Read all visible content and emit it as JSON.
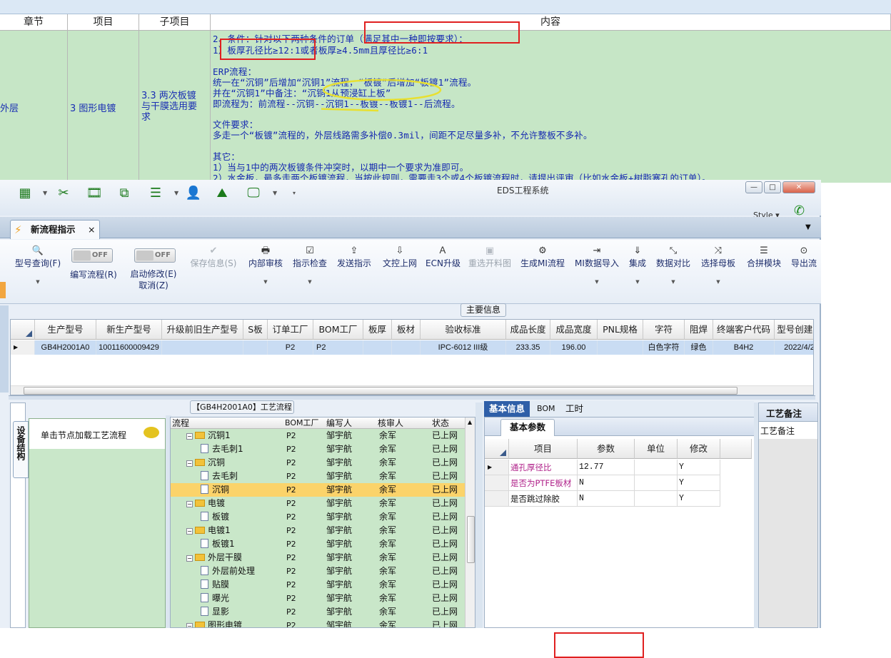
{
  "doc": {
    "headers": [
      "章节",
      "项目",
      "子项目",
      "内容"
    ],
    "row": {
      "chapter": "外层",
      "item": "3 图形电镀",
      "subitem": [
        "3.3 两次板镀",
        "与干膜选用要",
        "求"
      ],
      "content_lines": [
        "2、条件：针对以下两种条件的订单（满足其中一种即按要求）：",
        "1）板厚孔径比≥12:1或者板厚≥4.5mm且厚径比≥6:1",
        "",
        "ERP流程：",
        "统一在“沉铜”后增加“沉铜1”流程，“板镀”后增加“板镀1”流程。",
        "并在“沉铜1”中备注：“沉铜1从预浸缸上板”",
        "即流程为：前流程--沉铜--沉铜1--板镀--板镀1--后流程。",
        "",
        "文件要求：",
        "多走一个“板镀”流程的，外层线路需多补偿0.3mil，间距不足尽量多补，不允许整板不多补。",
        "",
        "其它：",
        "1）当与1中的两次板镀条件冲突时，以期中一个要求为准即可。",
        "2）水金板，最多走两个板镀流程，当按此规则，需要走3个或4个板镀流程时，请提出评审（比如水金板+树脂塞孔的订单）。"
      ]
    }
  },
  "app": {
    "title": "EDS工程系统",
    "style_label": "Style",
    "window_buttons": [
      "—",
      "□",
      "✕"
    ],
    "tab_label": "新流程指示",
    "tab_close": "×",
    "toolbar_icons": [
      "grid-icon",
      "scissors-icon",
      "film-icon",
      "copy-icon",
      "list-icon",
      "user-icon",
      "area-chart-icon",
      "monitor-icon"
    ],
    "ribbon": [
      {
        "icon": "🔍",
        "label": "型号查询(F)",
        "caret": true,
        "disabled": false
      },
      {
        "toggle": "OFF",
        "label": "编写流程(R)"
      },
      {
        "toggle": "OFF",
        "label": "启动修改(E)",
        "label2": "取消(Z)"
      },
      {
        "icon": "✔",
        "label": "保存信息(S)",
        "disabled": true
      },
      {
        "icon": "🖶",
        "label": "内部审核",
        "caret": true
      },
      {
        "icon": "☑",
        "label": "指示检查",
        "caret": true
      },
      {
        "icon": "⇪",
        "label": "发送指示"
      },
      {
        "icon": "⇩",
        "label": "文控上网"
      },
      {
        "icon": "⚑",
        "label": "ECN升级"
      },
      {
        "icon": "▣",
        "label": "重选开料图",
        "disabled": true
      },
      {
        "icon": "⚙",
        "label": "生成MI流程"
      },
      {
        "icon": "⇥",
        "label": "MI数据导入",
        "caret": true
      },
      {
        "icon": "⇓",
        "label": "集成",
        "caret": true
      },
      {
        "icon": "⤡",
        "label": "数据对比",
        "caret": true
      },
      {
        "icon": "⤨",
        "label": "选择母板",
        "caret": true
      },
      {
        "icon": "☰",
        "label": "合拼模块"
      },
      {
        "icon": "⊙",
        "label": "导出流"
      }
    ],
    "main_info": {
      "caption": "主要信息",
      "columns": [
        "生产型号",
        "新生产型号",
        "升级前旧生产型号",
        "S板",
        "订单工厂",
        "BOM工厂",
        "板厚",
        "板材",
        "验收标准",
        "成品长度",
        "成品宽度",
        "PNL规格",
        "字符",
        "阻焊",
        "终端客户代码",
        "型号创建时"
      ],
      "row": [
        "GB4H2001A0",
        "10011600009429",
        "",
        "",
        "P2",
        "P2",
        "",
        "",
        "IPC-6012 III级",
        "233.35",
        "196.00",
        "",
        "白色字符",
        "绿色",
        "B4H2",
        "2022/4/2"
      ]
    },
    "left_panel": {
      "side_tab": "设备结构",
      "hint": "单击节点加载工艺流程"
    },
    "process": {
      "title": "【GB4H2001A0】工艺流程",
      "columns": [
        "流程",
        "BOM工厂",
        "编写人",
        "核审人",
        "状态"
      ],
      "rows": [
        {
          "level": 0,
          "type": "folder",
          "name": "沉铜1",
          "bom": "P2",
          "author": "邹宇航",
          "reviewer": "余军",
          "status": "已上网"
        },
        {
          "level": 1,
          "type": "doc",
          "name": "去毛刺1",
          "bom": "P2",
          "author": "邹宇航",
          "reviewer": "余军",
          "status": "已上网"
        },
        {
          "level": 0,
          "type": "folder",
          "name": "沉铜",
          "bom": "P2",
          "author": "邹宇航",
          "reviewer": "余军",
          "status": "已上网"
        },
        {
          "level": 1,
          "type": "doc",
          "name": "去毛刺",
          "bom": "P2",
          "author": "邹宇航",
          "reviewer": "余军",
          "status": "已上网"
        },
        {
          "level": 1,
          "type": "doc",
          "name": "沉铜",
          "bom": "P2",
          "author": "邹宇航",
          "reviewer": "余军",
          "status": "已上网",
          "selected": true
        },
        {
          "level": 0,
          "type": "folder",
          "name": "电镀",
          "bom": "P2",
          "author": "邹宇航",
          "reviewer": "余军",
          "status": "已上网"
        },
        {
          "level": 1,
          "type": "doc",
          "name": "板镀",
          "bom": "P2",
          "author": "邹宇航",
          "reviewer": "余军",
          "status": "已上网"
        },
        {
          "level": 0,
          "type": "folder",
          "name": "电镀1",
          "bom": "P2",
          "author": "邹宇航",
          "reviewer": "余军",
          "status": "已上网"
        },
        {
          "level": 1,
          "type": "doc",
          "name": "板镀1",
          "bom": "P2",
          "author": "邹宇航",
          "reviewer": "余军",
          "status": "已上网"
        },
        {
          "level": 0,
          "type": "folder",
          "name": "外层干膜",
          "bom": "P2",
          "author": "邹宇航",
          "reviewer": "余军",
          "status": "已上网"
        },
        {
          "level": 1,
          "type": "doc",
          "name": "外层前处理",
          "bom": "P2",
          "author": "邹宇航",
          "reviewer": "余军",
          "status": "已上网"
        },
        {
          "level": 1,
          "type": "doc",
          "name": "贴膜",
          "bom": "P2",
          "author": "邹宇航",
          "reviewer": "余军",
          "status": "已上网"
        },
        {
          "level": 1,
          "type": "doc",
          "name": "曝光",
          "bom": "P2",
          "author": "邹宇航",
          "reviewer": "余军",
          "status": "已上网"
        },
        {
          "level": 1,
          "type": "doc",
          "name": "显影",
          "bom": "P2",
          "author": "邹宇航",
          "reviewer": "余军",
          "status": "已上网"
        },
        {
          "level": 0,
          "type": "folder",
          "name": "图形电镀",
          "bom": "P2",
          "author": "邹宇航",
          "reviewer": "余军",
          "status": "已上网"
        }
      ]
    },
    "detail": {
      "tabs": [
        "基本信息",
        "BOM",
        "工时"
      ],
      "subtab": "基本参数",
      "columns": [
        "项目",
        "参数",
        "单位",
        "修改"
      ],
      "rows": [
        {
          "item": "通孔厚径比",
          "param": "12.77",
          "unit": "",
          "modify": "Y"
        },
        {
          "item": "是否为PTFE板材",
          "param": "N",
          "unit": "",
          "modify": "Y"
        },
        {
          "item": "是否跳过除胶",
          "param": "N",
          "unit": "",
          "modify": "Y"
        }
      ],
      "remark_tab": "工艺备注",
      "remark_col": "工艺备注"
    }
  },
  "annotations": {
    "red": "#e02020",
    "yellow": "#e8e030",
    "accent_green": "#1b7a1b"
  }
}
